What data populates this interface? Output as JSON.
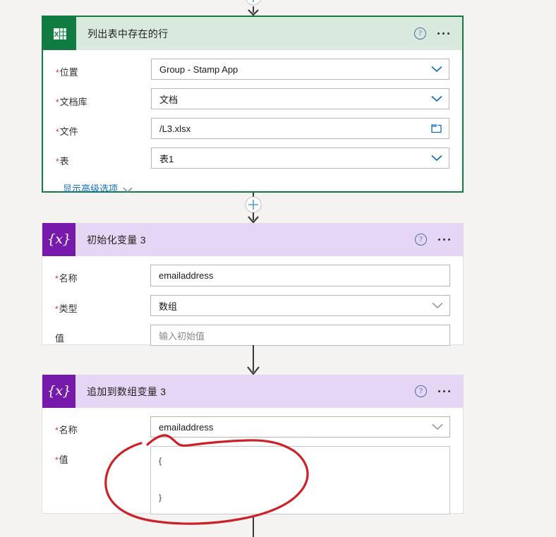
{
  "theme": {
    "page_background": "#f4f3f2",
    "excel_accent": "#107c41",
    "excel_header_background": "#d9e9dd",
    "variable_accent": "#7719aa",
    "variable_header_background": "#e6d6f5",
    "required_star_color": "#c4314b",
    "link_color": "#0f6cbd",
    "annotation_color": "#cc2127"
  },
  "cards": [
    {
      "id": "list-rows-present-in-table",
      "title": "列出表中存在的行",
      "icon": "excel-icon",
      "help_icon": "?",
      "more_icon": "ellipsis-icon",
      "fields": [
        {
          "label": "位置",
          "required": true,
          "value": "Group - Stamp App",
          "control": "dropdown"
        },
        {
          "label": "文档库",
          "required": true,
          "value": "文档",
          "control": "dropdown"
        },
        {
          "label": "文件",
          "required": true,
          "value": "/L3.xlsx",
          "control": "filepicker"
        },
        {
          "label": "表",
          "required": true,
          "value": "表1",
          "control": "dropdown"
        }
      ],
      "advanced_link": "显示高级选项"
    },
    {
      "id": "initialize-variable-3",
      "title": "初始化变量 3",
      "icon": "variable-icon",
      "help_icon": "?",
      "more_icon": "ellipsis-icon",
      "fields": [
        {
          "label": "名称",
          "required": true,
          "value": "emailaddress",
          "control": "text"
        },
        {
          "label": "类型",
          "required": true,
          "value": "数组",
          "control": "dropdown"
        },
        {
          "label": "值",
          "required": false,
          "value": "",
          "placeholder": "输入初始值",
          "control": "text"
        }
      ]
    },
    {
      "id": "append-to-array-variable-3",
      "title": "追加到数组变量 3",
      "icon": "variable-icon",
      "help_icon": "?",
      "more_icon": "ellipsis-icon",
      "fields": [
        {
          "label": "名称",
          "required": true,
          "value": "emailaddress",
          "control": "dropdown"
        },
        {
          "label": "值",
          "required": true,
          "value": "{\n\n}",
          "control": "textarea"
        }
      ]
    }
  ],
  "connectors": {
    "top": {
      "type": "insert-step-button",
      "label": "+"
    },
    "between_1_2": {
      "type": "insert-step-button",
      "label": "+"
    },
    "between_2_3": {
      "type": "arrow"
    },
    "bottom": {
      "type": "line"
    }
  },
  "annotation": {
    "shape": "hand-drawn-ellipse",
    "color": "#cc2127",
    "targets": "append-to-array-value-textarea"
  }
}
